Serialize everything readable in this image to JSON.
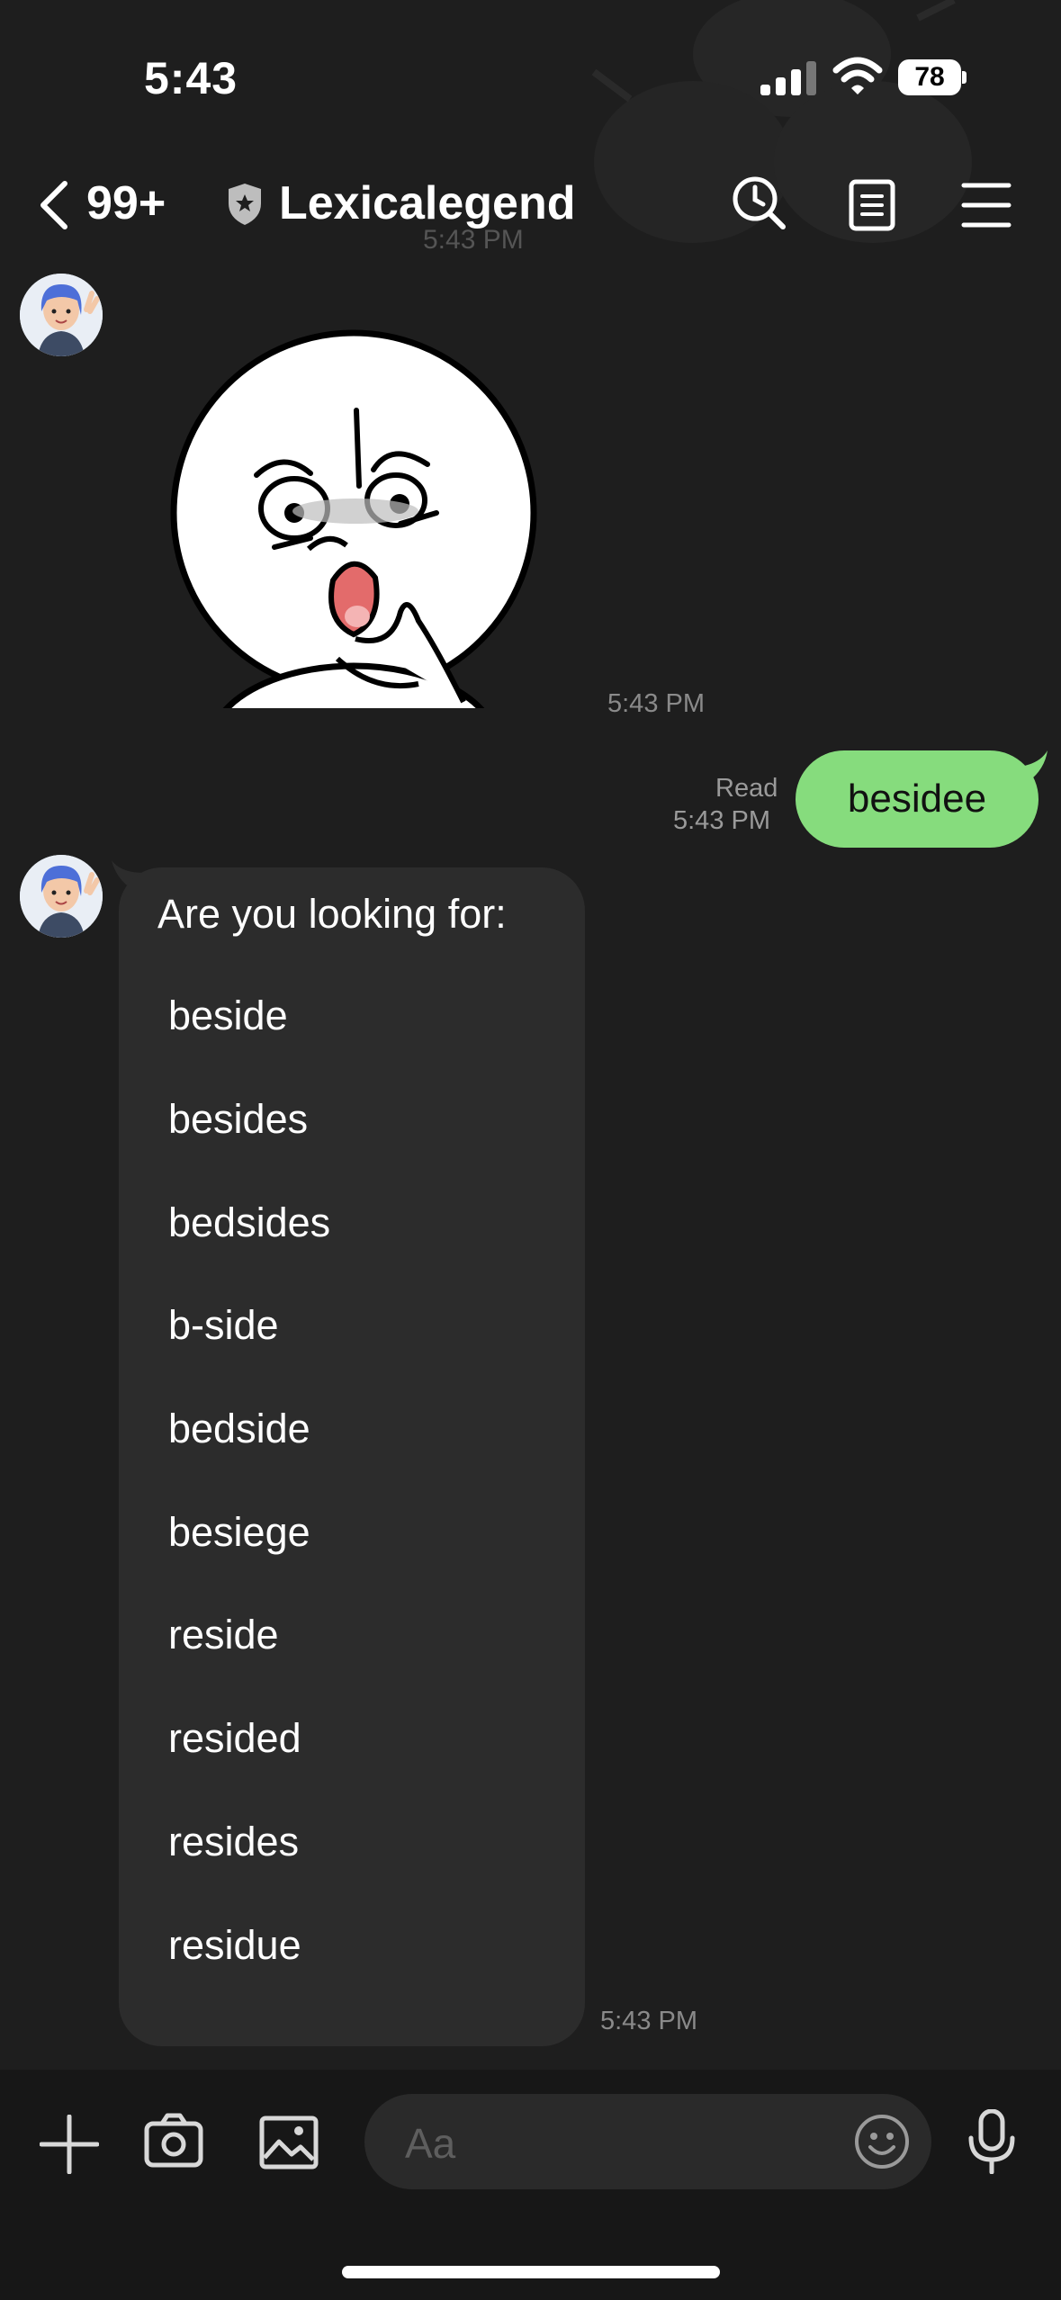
{
  "status_bar": {
    "time": "5:43",
    "battery": "78"
  },
  "header": {
    "unread_count": "99+",
    "title": "Lexicalegend",
    "ghost_time": "5:43 PM"
  },
  "messages": {
    "sticker_time": "5:43 PM",
    "outgoing": {
      "text": "besidee",
      "read_label": "Read",
      "time": "5:43 PM"
    },
    "incoming": {
      "heading": "Are you looking for:",
      "suggestions": [
        "beside",
        "besides",
        "bedsides",
        "b-side",
        "bedside",
        "besiege",
        "reside",
        "resided",
        "resides",
        "residue"
      ],
      "time": "5:43 PM"
    }
  },
  "composer": {
    "placeholder": "Aa"
  },
  "colors": {
    "background": "#1e1e1e",
    "outgoing_bubble": "#86dc7d",
    "incoming_bubble": "#2c2c2c",
    "bottom_bar": "#171717"
  },
  "icons": [
    "back-icon",
    "shield-icon",
    "search-clock-icon",
    "notes-icon",
    "menu-icon",
    "plus-icon",
    "camera-icon",
    "image-icon",
    "emoji-icon",
    "mic-icon"
  ]
}
